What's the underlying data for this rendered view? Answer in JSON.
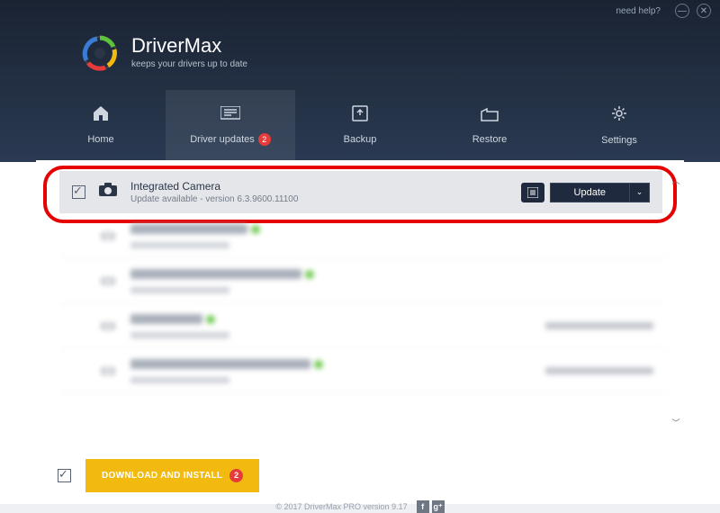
{
  "titlebar": {
    "help": "need help?"
  },
  "brand": {
    "name": "DriverMax",
    "tagline": "keeps your drivers up to date"
  },
  "tabs": [
    {
      "label": "Home"
    },
    {
      "label": "Driver updates",
      "badge": "2"
    },
    {
      "label": "Backup"
    },
    {
      "label": "Restore"
    },
    {
      "label": "Settings"
    }
  ],
  "device": {
    "name": "Integrated Camera",
    "status": "Update available - version 6.3.9600.11100",
    "action": "Update"
  },
  "blurred": [
    {
      "title_w": 130,
      "note": ""
    },
    {
      "title_w": 190,
      "note": ""
    },
    {
      "title_w": 80,
      "note": "Driver updated on 03-Nov-16"
    },
    {
      "title_w": 200,
      "note": "Driver updated on 03-Nov-16"
    }
  ],
  "install": {
    "label": "DOWNLOAD AND INSTALL",
    "badge": "2"
  },
  "footer": "© 2017 DriverMax PRO version 9.17"
}
